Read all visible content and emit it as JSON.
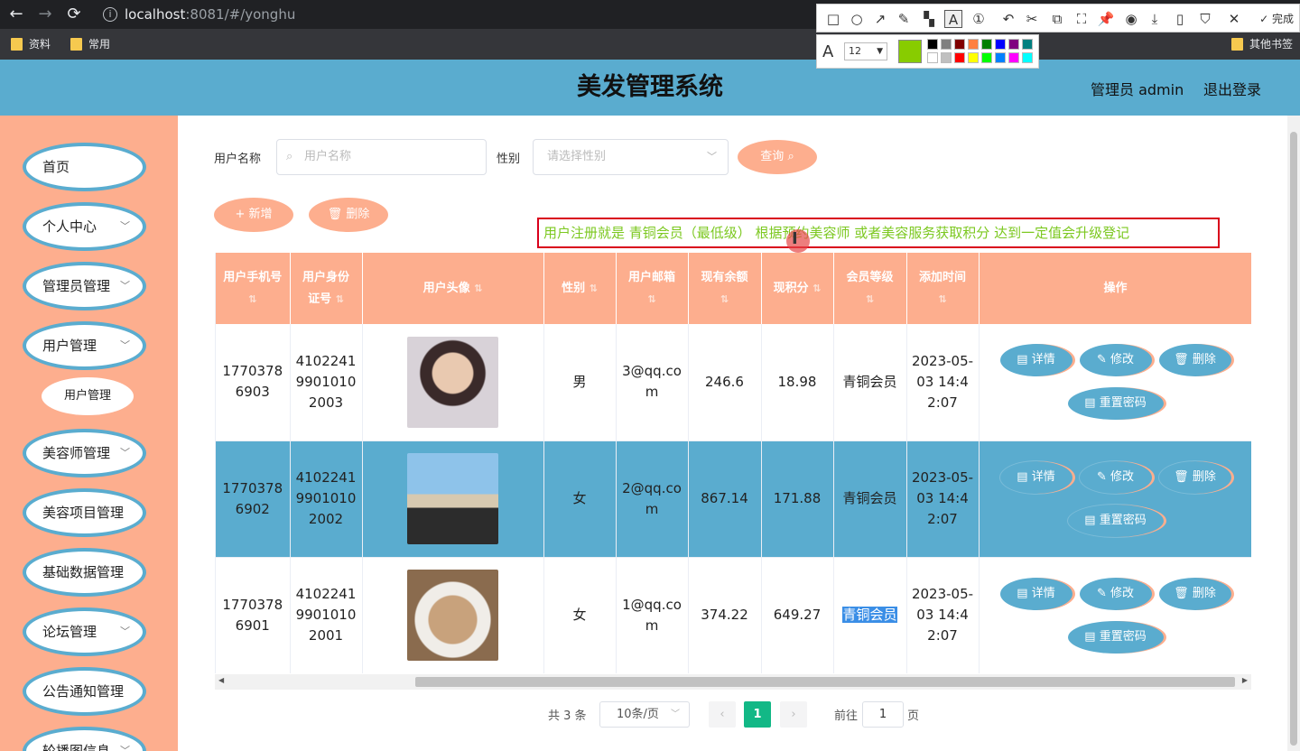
{
  "browser": {
    "url_host": "localhost",
    "url_path": ":8081/#/yonghu",
    "bookmarks": [
      "资料",
      "常用"
    ],
    "other_bookmarks": "其他书签"
  },
  "snip_tool": {
    "done_label": "完成",
    "font_size": "12",
    "current_color": "#88cc00",
    "palette": [
      "#000000",
      "#808080",
      "#800000",
      "#ff8040",
      "#008000",
      "#0000ff",
      "#800080",
      "#008080",
      "#ffffff",
      "#c0c0c0",
      "#ff0000",
      "#ffff00",
      "#00ff00",
      "#0080ff",
      "#ff00ff",
      "#00ffff"
    ]
  },
  "header": {
    "title": "美发管理系统",
    "admin_label": "管理员 admin",
    "logout_label": "退出登录"
  },
  "sidebar": {
    "items": [
      {
        "label": "首页",
        "has_arrow": false
      },
      {
        "label": "个人中心",
        "has_arrow": true
      },
      {
        "label": "管理员管理",
        "has_arrow": true
      },
      {
        "label": "用户管理",
        "has_arrow": true
      },
      {
        "label": "美容师管理",
        "has_arrow": true
      },
      {
        "label": "美容项目管理",
        "has_arrow": true
      },
      {
        "label": "基础数据管理",
        "has_arrow": true
      },
      {
        "label": "论坛管理",
        "has_arrow": true
      },
      {
        "label": "公告通知管理",
        "has_arrow": true
      },
      {
        "label": "轮播图信息",
        "has_arrow": true
      }
    ],
    "sub_item": "用户管理"
  },
  "search": {
    "username_label": "用户名称",
    "username_placeholder": "用户名称",
    "gender_label": "性别",
    "gender_placeholder": "请选择性别",
    "query_label": "查询"
  },
  "actions": {
    "add_label": "新增",
    "delete_label": "删除"
  },
  "notice": "用户注册就是 青铜会员（最低级） 根据预约美容师 或者美容服务获取积分 达到一定值会升级登记",
  "table": {
    "columns": [
      "用户手机号",
      "用户身份证号",
      "用户头像",
      "性别",
      "用户邮箱",
      "现有余额",
      "现积分",
      "会员等级",
      "添加时间",
      "操作"
    ],
    "rows": [
      {
        "phone": "17703786903",
        "id_card": "410224199010102003",
        "gender": "男",
        "email": "3@qq.com",
        "balance": "246.6",
        "points": "18.98",
        "level": "青铜会员",
        "time": "2023-05-03 14:42:07"
      },
      {
        "phone": "17703786902",
        "id_card": "410224199010102002",
        "gender": "女",
        "email": "2@qq.com",
        "balance": "867.14",
        "points": "171.88",
        "level": "青铜会员",
        "time": "2023-05-03 14:42:07"
      },
      {
        "phone": "17703786901",
        "id_card": "410224199010102001",
        "gender": "女",
        "email": "1@qq.com",
        "balance": "374.22",
        "points": "649.27",
        "level": "青铜会员",
        "time": "2023-05-03 14:42:07"
      }
    ],
    "ops": {
      "detail": "详情",
      "edit": "修改",
      "delete": "删除",
      "reset": "重置密码"
    }
  },
  "pagination": {
    "total_label": "共 3 条",
    "page_size": "10条/页",
    "current_page": "1",
    "goto_label": "前往",
    "goto_value": "1",
    "page_label": "页"
  }
}
